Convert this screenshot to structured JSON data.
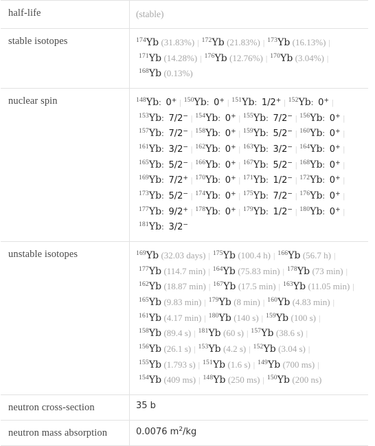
{
  "table": {
    "rows": [
      {
        "label": "half-life",
        "type": "note",
        "value": "(stable)"
      },
      {
        "label": "stable isotopes",
        "type": "isotopes"
      },
      {
        "label": "nuclear spin",
        "type": "spins"
      },
      {
        "label": "unstable isotopes",
        "type": "unstable"
      },
      {
        "label": "neutron cross-section",
        "type": "plain",
        "value": "35 b"
      },
      {
        "label": "neutron mass absorption",
        "type": "unit",
        "value_number": "0.0076",
        "value_unit_base": "m",
        "value_unit_sup": "2",
        "value_unit_tail": "/kg"
      }
    ]
  },
  "element_symbol": "Yb",
  "stable_isotopes": [
    {
      "mass": "174",
      "symbol": "Yb",
      "abundance": "(31.83%)"
    },
    {
      "mass": "172",
      "symbol": "Yb",
      "abundance": "(21.83%)"
    },
    {
      "mass": "173",
      "symbol": "Yb",
      "abundance": "(16.13%)"
    },
    {
      "mass": "171",
      "symbol": "Yb",
      "abundance": "(14.28%)"
    },
    {
      "mass": "176",
      "symbol": "Yb",
      "abundance": "(12.76%)"
    },
    {
      "mass": "170",
      "symbol": "Yb",
      "abundance": "(3.04%)"
    },
    {
      "mass": "168",
      "symbol": "Yb",
      "abundance": "(0.13%)"
    }
  ],
  "nuclear_spins": [
    {
      "mass": "148",
      "symbol": "Yb",
      "spin": "0",
      "parity": "+"
    },
    {
      "mass": "150",
      "symbol": "Yb",
      "spin": "0",
      "parity": "+"
    },
    {
      "mass": "151",
      "symbol": "Yb",
      "spin": "1/2",
      "parity": "+"
    },
    {
      "mass": "152",
      "symbol": "Yb",
      "spin": "0",
      "parity": "+"
    },
    {
      "mass": "153",
      "symbol": "Yb",
      "spin": "7/2",
      "parity": "−"
    },
    {
      "mass": "154",
      "symbol": "Yb",
      "spin": "0",
      "parity": "+"
    },
    {
      "mass": "155",
      "symbol": "Yb",
      "spin": "7/2",
      "parity": "−"
    },
    {
      "mass": "156",
      "symbol": "Yb",
      "spin": "0",
      "parity": "+"
    },
    {
      "mass": "157",
      "symbol": "Yb",
      "spin": "7/2",
      "parity": "−"
    },
    {
      "mass": "158",
      "symbol": "Yb",
      "spin": "0",
      "parity": "+"
    },
    {
      "mass": "159",
      "symbol": "Yb",
      "spin": "5/2",
      "parity": "−"
    },
    {
      "mass": "160",
      "symbol": "Yb",
      "spin": "0",
      "parity": "+"
    },
    {
      "mass": "161",
      "symbol": "Yb",
      "spin": "3/2",
      "parity": "−"
    },
    {
      "mass": "162",
      "symbol": "Yb",
      "spin": "0",
      "parity": "+"
    },
    {
      "mass": "163",
      "symbol": "Yb",
      "spin": "3/2",
      "parity": "−"
    },
    {
      "mass": "164",
      "symbol": "Yb",
      "spin": "0",
      "parity": "+"
    },
    {
      "mass": "165",
      "symbol": "Yb",
      "spin": "5/2",
      "parity": "−"
    },
    {
      "mass": "166",
      "symbol": "Yb",
      "spin": "0",
      "parity": "+"
    },
    {
      "mass": "167",
      "symbol": "Yb",
      "spin": "5/2",
      "parity": "−"
    },
    {
      "mass": "168",
      "symbol": "Yb",
      "spin": "0",
      "parity": "+"
    },
    {
      "mass": "169",
      "symbol": "Yb",
      "spin": "7/2",
      "parity": "+"
    },
    {
      "mass": "170",
      "symbol": "Yb",
      "spin": "0",
      "parity": "+"
    },
    {
      "mass": "171",
      "symbol": "Yb",
      "spin": "1/2",
      "parity": "−"
    },
    {
      "mass": "172",
      "symbol": "Yb",
      "spin": "0",
      "parity": "+"
    },
    {
      "mass": "173",
      "symbol": "Yb",
      "spin": "5/2",
      "parity": "−"
    },
    {
      "mass": "174",
      "symbol": "Yb",
      "spin": "0",
      "parity": "+"
    },
    {
      "mass": "175",
      "symbol": "Yb",
      "spin": "7/2",
      "parity": "−"
    },
    {
      "mass": "176",
      "symbol": "Yb",
      "spin": "0",
      "parity": "+"
    },
    {
      "mass": "177",
      "symbol": "Yb",
      "spin": "9/2",
      "parity": "+"
    },
    {
      "mass": "178",
      "symbol": "Yb",
      "spin": "0",
      "parity": "+"
    },
    {
      "mass": "179",
      "symbol": "Yb",
      "spin": "1/2",
      "parity": "−"
    },
    {
      "mass": "180",
      "symbol": "Yb",
      "spin": "0",
      "parity": "+"
    },
    {
      "mass": "181",
      "symbol": "Yb",
      "spin": "3/2",
      "parity": "−"
    }
  ],
  "unstable_isotopes": [
    {
      "mass": "169",
      "symbol": "Yb",
      "halflife": "(32.03 days)"
    },
    {
      "mass": "175",
      "symbol": "Yb",
      "halflife": "(100.4 h)"
    },
    {
      "mass": "166",
      "symbol": "Yb",
      "halflife": "(56.7 h)"
    },
    {
      "mass": "177",
      "symbol": "Yb",
      "halflife": "(114.7 min)"
    },
    {
      "mass": "164",
      "symbol": "Yb",
      "halflife": "(75.83 min)"
    },
    {
      "mass": "178",
      "symbol": "Yb",
      "halflife": "(73 min)"
    },
    {
      "mass": "162",
      "symbol": "Yb",
      "halflife": "(18.87 min)"
    },
    {
      "mass": "167",
      "symbol": "Yb",
      "halflife": "(17.5 min)"
    },
    {
      "mass": "163",
      "symbol": "Yb",
      "halflife": "(11.05 min)"
    },
    {
      "mass": "165",
      "symbol": "Yb",
      "halflife": "(9.83 min)"
    },
    {
      "mass": "179",
      "symbol": "Yb",
      "halflife": "(8 min)"
    },
    {
      "mass": "160",
      "symbol": "Yb",
      "halflife": "(4.83 min)"
    },
    {
      "mass": "161",
      "symbol": "Yb",
      "halflife": "(4.17 min)"
    },
    {
      "mass": "180",
      "symbol": "Yb",
      "halflife": "(140 s)"
    },
    {
      "mass": "159",
      "symbol": "Yb",
      "halflife": "(100 s)"
    },
    {
      "mass": "158",
      "symbol": "Yb",
      "halflife": "(89.4 s)"
    },
    {
      "mass": "181",
      "symbol": "Yb",
      "halflife": "(60 s)"
    },
    {
      "mass": "157",
      "symbol": "Yb",
      "halflife": "(38.6 s)"
    },
    {
      "mass": "156",
      "symbol": "Yb",
      "halflife": "(26.1 s)"
    },
    {
      "mass": "153",
      "symbol": "Yb",
      "halflife": "(4.2 s)"
    },
    {
      "mass": "152",
      "symbol": "Yb",
      "halflife": "(3.04 s)"
    },
    {
      "mass": "155",
      "symbol": "Yb",
      "halflife": "(1.793 s)"
    },
    {
      "mass": "151",
      "symbol": "Yb",
      "halflife": "(1.6 s)"
    },
    {
      "mass": "149",
      "symbol": "Yb",
      "halflife": "(700 ms)"
    },
    {
      "mass": "154",
      "symbol": "Yb",
      "halflife": "(409 ms)"
    },
    {
      "mass": "148",
      "symbol": "Yb",
      "halflife": "(250 ms)"
    },
    {
      "mass": "150",
      "symbol": "Yb",
      "halflife": "(200 ns)"
    }
  ],
  "separator": "|"
}
